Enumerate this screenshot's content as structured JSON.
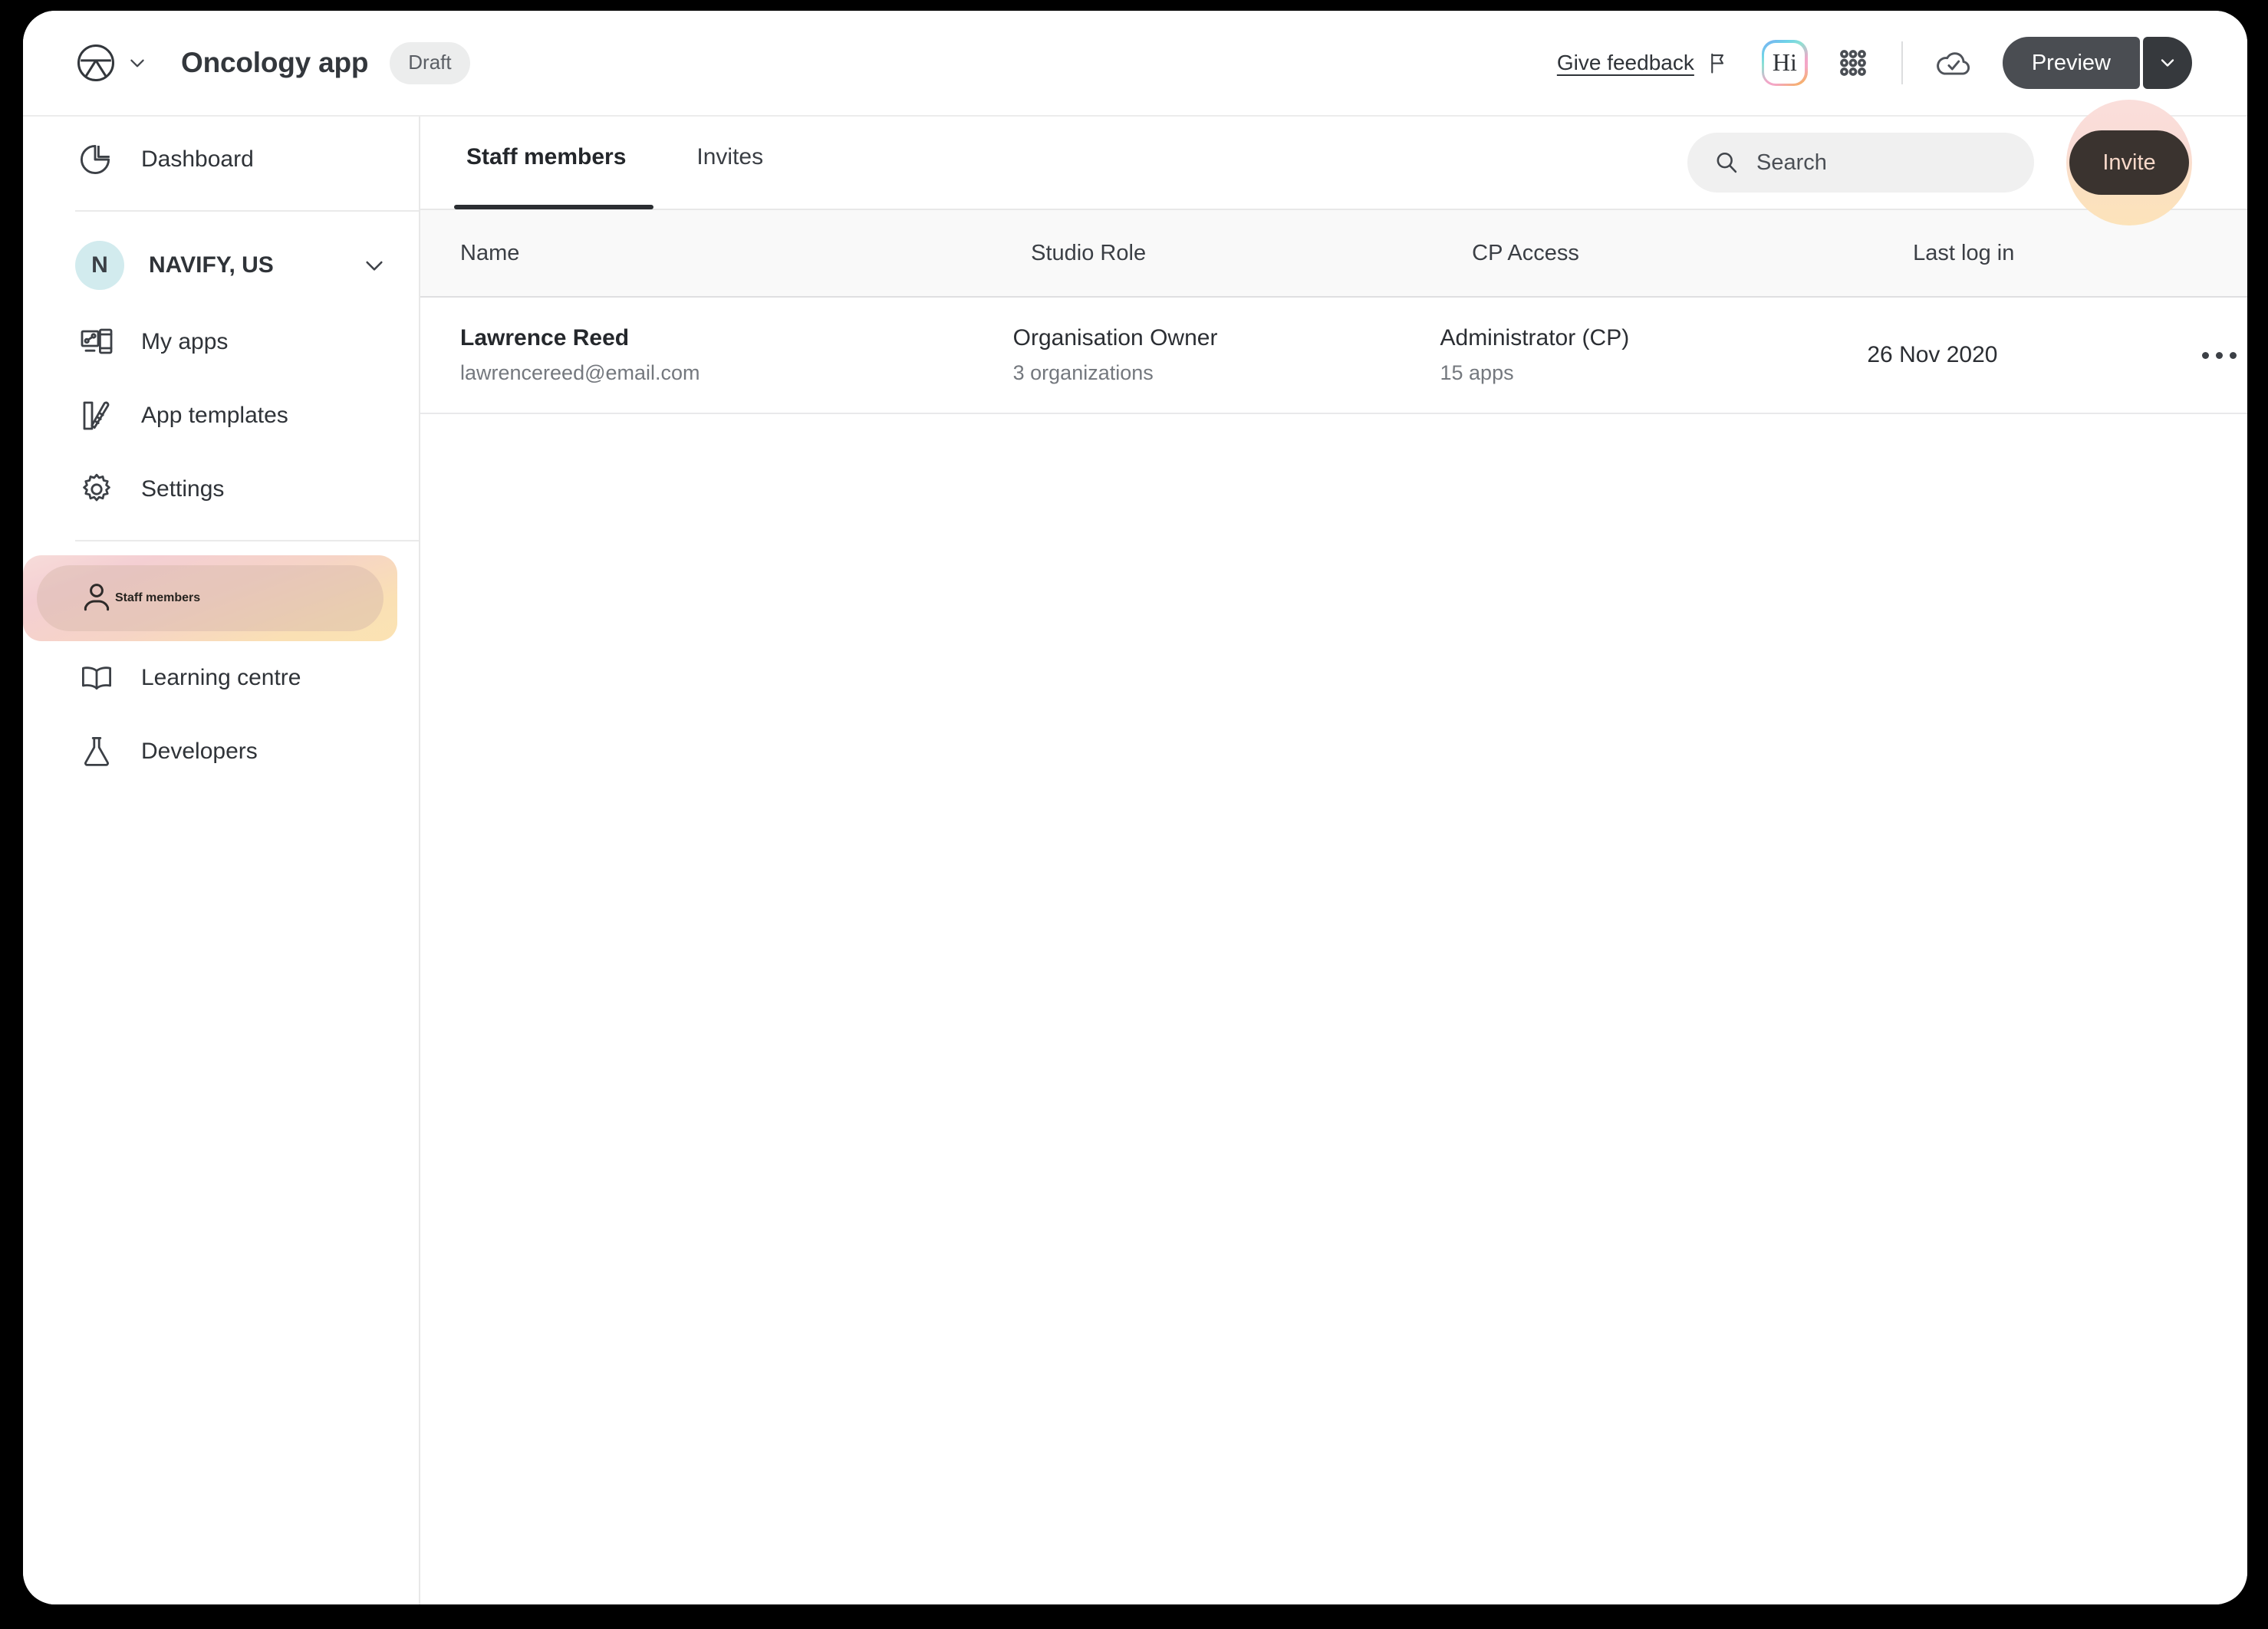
{
  "header": {
    "logo_icon": "roche-circle-logo",
    "app_title": "Oncology app",
    "status_badge": "Draft",
    "give_feedback": "Give feedback",
    "flag_icon": "flag-icon",
    "hi_badge": "Hi",
    "grid_icon": "apps-grid-icon",
    "cloud_icon": "cloud-check-icon",
    "preview_label": "Preview",
    "preview_caret_icon": "chevron-down-icon",
    "brand_caret_icon": "chevron-down-icon"
  },
  "sidebar": {
    "top_items": [
      {
        "label": "Dashboard",
        "icon": "pie-chart-icon"
      }
    ],
    "org": {
      "initial": "N",
      "name": "NAVIFY, US",
      "caret_icon": "chevron-down-icon",
      "avatar_color": "#d2ebee"
    },
    "items": [
      {
        "label": "My apps",
        "icon": "devices-icon",
        "active": false
      },
      {
        "label": "App templates",
        "icon": "template-ruler-icon",
        "active": false
      },
      {
        "label": "Settings",
        "icon": "gear-icon",
        "active": false
      },
      {
        "label": "Staff members",
        "icon": "user-icon",
        "active": true
      },
      {
        "label": "Learning centre",
        "icon": "book-icon",
        "active": false
      },
      {
        "label": "Developers",
        "icon": "flask-icon",
        "active": false
      }
    ]
  },
  "main": {
    "tabs": [
      {
        "label": "Staff members",
        "active": true
      },
      {
        "label": "Invites",
        "active": false
      }
    ],
    "search": {
      "placeholder": "Search",
      "value": "",
      "icon": "search-icon"
    },
    "invite_button": "Invite",
    "table": {
      "columns": [
        "Name",
        "Studio Role",
        "CP Access",
        "Last log in"
      ],
      "rows": [
        {
          "name": "Lawrence Reed",
          "email": "lawrencereed@email.com",
          "studio_role": "Organisation Owner",
          "studio_role_sub": "3 organizations",
          "cp_access": "Administrator (CP)",
          "cp_access_sub": "15 apps",
          "last_login": "26 Nov 2020",
          "actions_icon": "more-horizontal-icon"
        }
      ]
    }
  },
  "colors": {
    "accent_dark": "#3a332f",
    "preview_button": "#4a4d52",
    "active_nav_gradient_start": "#f7dcd9",
    "active_nav_gradient_end": "#fbe3b3",
    "invite_text": "#f7d8c9"
  }
}
